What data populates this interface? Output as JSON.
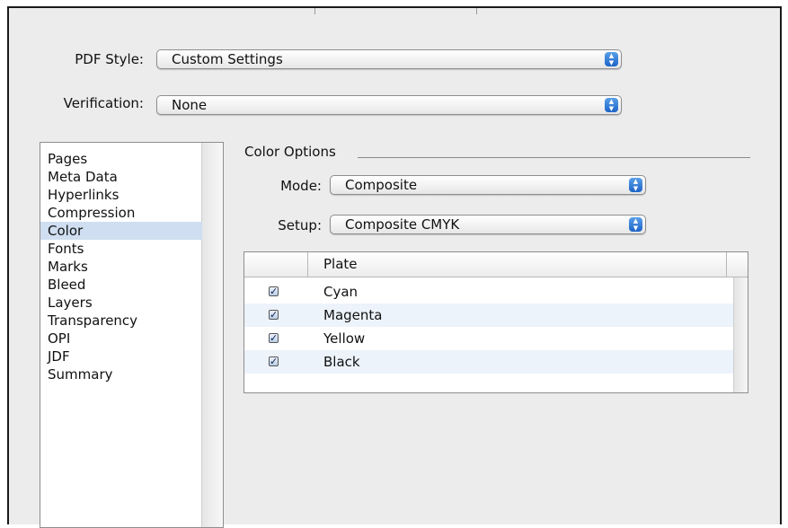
{
  "pdf_style": {
    "label": "PDF Style:",
    "value": "Custom Settings"
  },
  "verification": {
    "label": "Verification:",
    "value": "None"
  },
  "sidebar": {
    "selected": "Color",
    "items": [
      "Pages",
      "Meta Data",
      "Hyperlinks",
      "Compression",
      "Color",
      "Fonts",
      "Marks",
      "Bleed",
      "Layers",
      "Transparency",
      "OPI",
      "JDF",
      "Summary"
    ]
  },
  "color_options": {
    "title": "Color Options",
    "mode": {
      "label": "Mode:",
      "value": "Composite"
    },
    "setup": {
      "label": "Setup:",
      "value": "Composite CMYK"
    }
  },
  "plates_table": {
    "header": "Plate",
    "rows": [
      {
        "name": "Cyan",
        "checked": true
      },
      {
        "name": "Magenta",
        "checked": true
      },
      {
        "name": "Yellow",
        "checked": true
      },
      {
        "name": "Black",
        "checked": true
      }
    ]
  },
  "icons": {
    "popup_arrows": "up-down-arrows-icon",
    "checkbox": "checkmark-icon"
  },
  "colors": {
    "selection": "#cfdef0",
    "alt_row": "#edf3fb",
    "popup_arrow": "#1c63c8",
    "window_bg": "#ececec"
  }
}
